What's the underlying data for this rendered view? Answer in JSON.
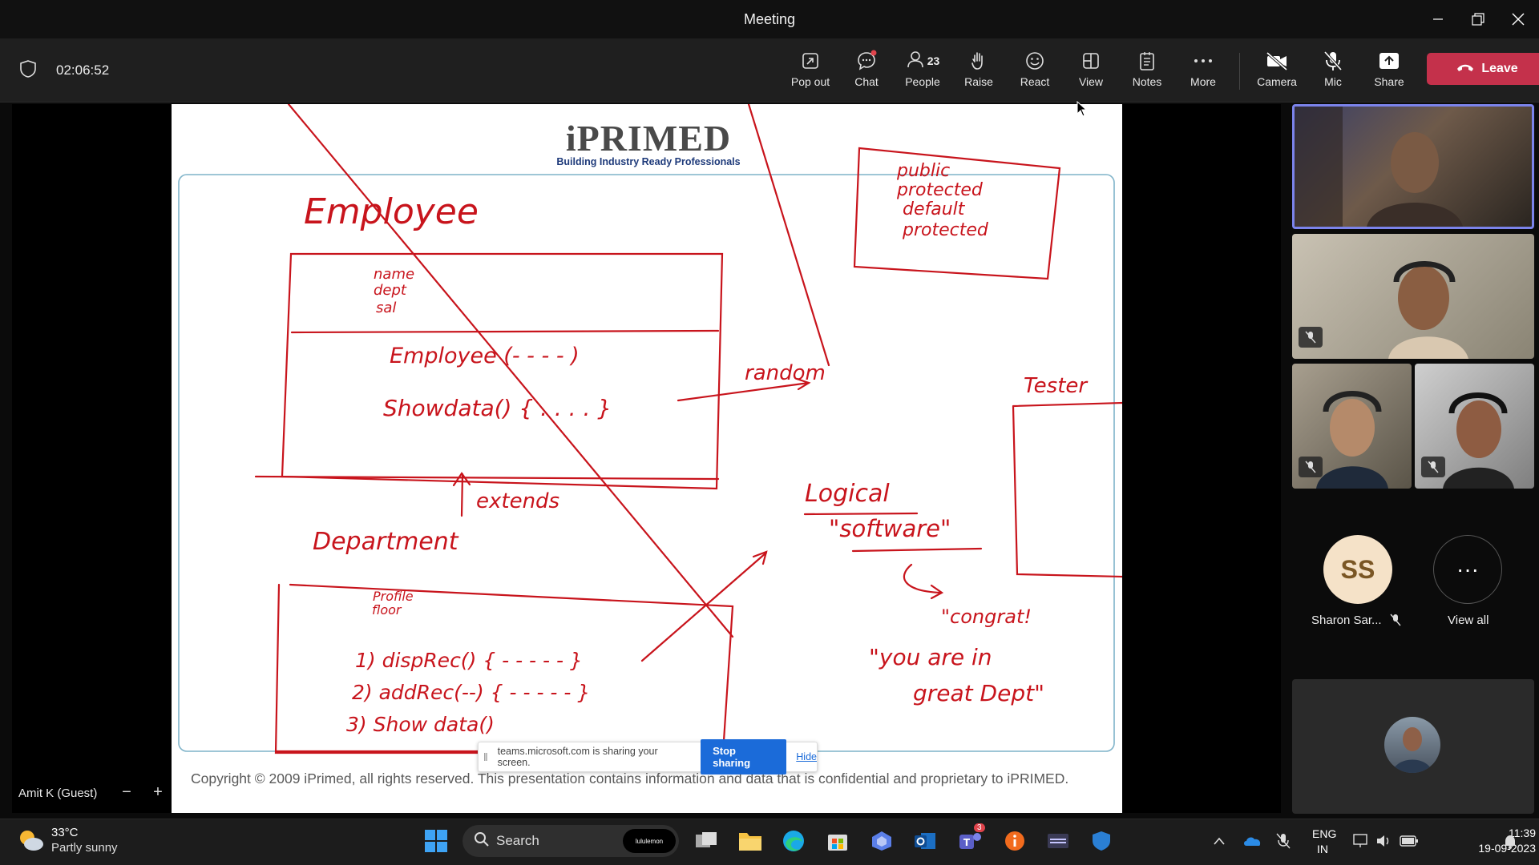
{
  "window": {
    "title": "Meeting"
  },
  "toolbar": {
    "timer": "02:06:52",
    "pop_out": "Pop out",
    "chat": "Chat",
    "people": "People",
    "people_count": "23",
    "raise": "Raise",
    "react": "React",
    "view": "View",
    "notes": "Notes",
    "more": "More",
    "camera": "Camera",
    "mic": "Mic",
    "share": "Share",
    "leave": "Leave"
  },
  "slide": {
    "brand_name": "iPRIMED",
    "brand_tagline": "Building Industry Ready Professionals",
    "copyright": "Copyright © 2009 iPrimed, all rights reserved. This presentation contains information  and data  that is confidential and proprietary to iPRIMED.",
    "handwriting": {
      "title": "Employee",
      "fields": [
        "name",
        "dept",
        "sal"
      ],
      "constructor": "Employee (- - - - )",
      "method": "Showdata() { . . . . }",
      "random": "random",
      "access": [
        "public",
        "protected",
        "default",
        "protected"
      ],
      "extends": "extends",
      "department": "Department",
      "dept_fields": [
        "Profile",
        "floor"
      ],
      "dept_methods": [
        "1) dispRec() { - - - - - }",
        "2) addRec(--) { - - - - - }",
        "3) Show data()"
      ],
      "tester": "Tester",
      "logical": "Logical",
      "software": "\"software\"",
      "congrat": "\"congrat!",
      "you_are_in": "\"you are in",
      "great_dept": "great Dept\""
    }
  },
  "share_banner": {
    "message": "teams.microsoft.com is sharing your screen.",
    "stop": "Stop sharing",
    "hide": "Hide"
  },
  "self_view": {
    "name": "Amit K (Guest)"
  },
  "participants": {
    "sharon_initials": "SS",
    "sharon_name": "Sharon Sar...",
    "view_all": "View all"
  },
  "taskbar": {
    "temperature": "33°C",
    "weather": "Partly sunny",
    "search": "Search",
    "ad": "lululemon",
    "teams_badge": "3",
    "lang_line1": "ENG",
    "lang_line2": "IN",
    "time": "11:39",
    "date": "19-09-2023"
  },
  "colors": {
    "leave": "#c4314b",
    "ink": "#c8141c",
    "stop_sharing": "#1b6bd9",
    "slide_frame": "#7fb3c9"
  },
  "icons": [
    "shield-icon",
    "pop-out-icon",
    "chat-icon",
    "people-icon",
    "raise-hand-icon",
    "react-icon",
    "view-icon",
    "notes-icon",
    "more-icon",
    "camera-off-icon",
    "mic-off-icon",
    "share-icon",
    "phone-icon"
  ]
}
